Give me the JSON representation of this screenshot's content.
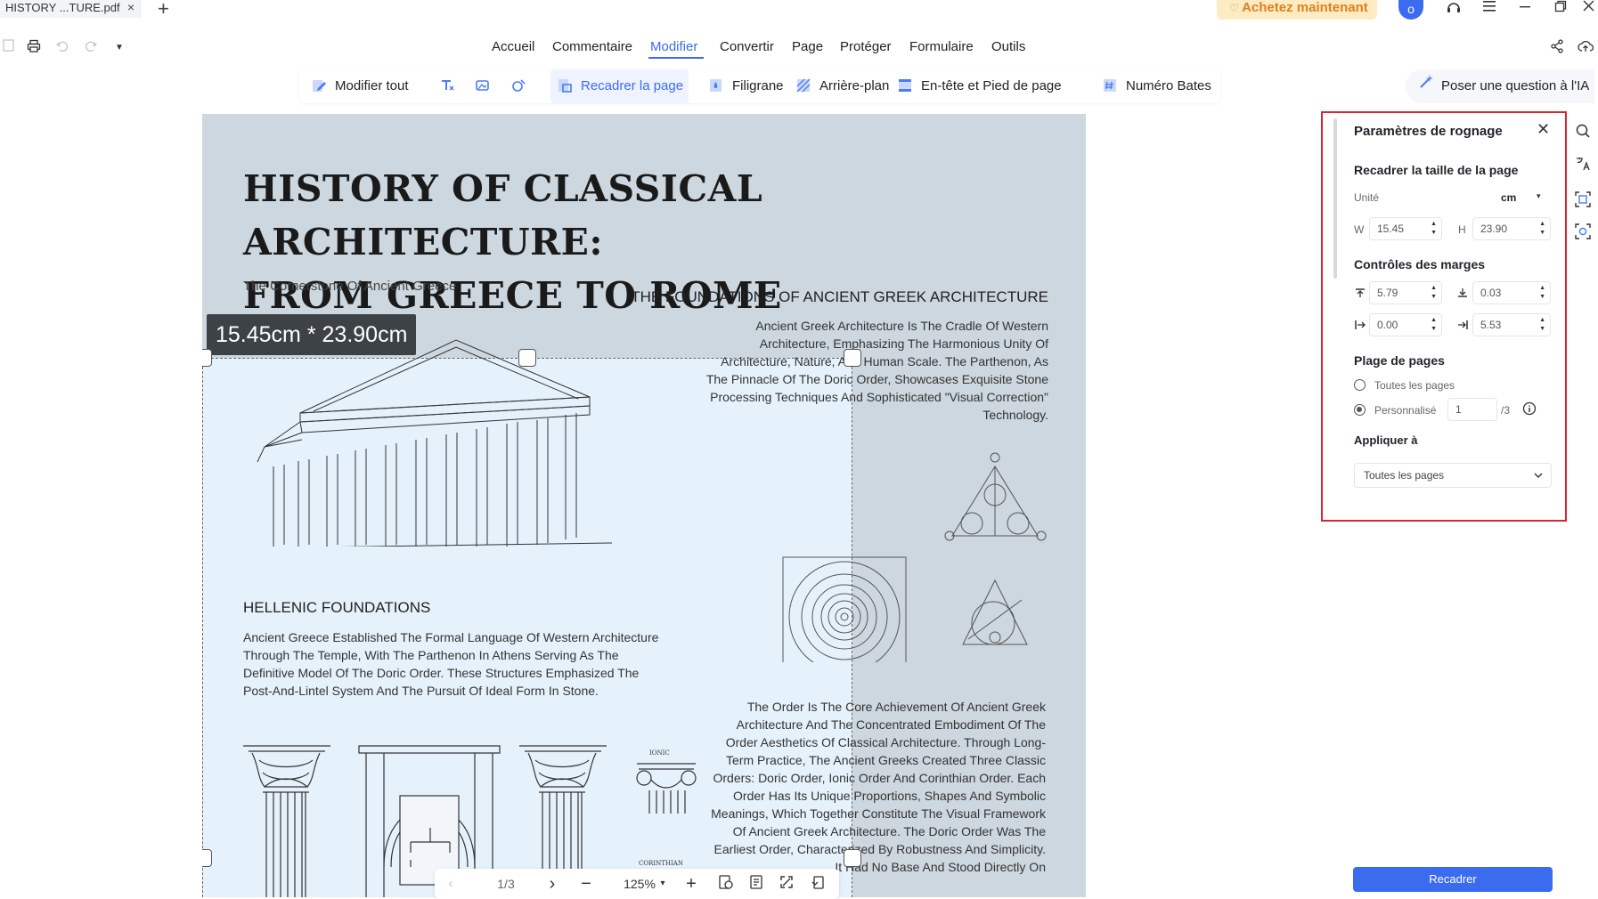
{
  "tab": {
    "title": "HISTORY ...TURE.pdf",
    "close": "×",
    "new_tab": "+"
  },
  "titlebar": {
    "buy_label": "Achetez maintenant",
    "avatar_letter": "o"
  },
  "menu": [
    "Accueil",
    "Commentaire",
    "Modifier",
    "Convertir",
    "Page",
    "Protéger",
    "Formulaire",
    "Outils"
  ],
  "ribbon": {
    "edit_all": "Modifier tout",
    "crop_page": "Recadrer la page",
    "watermark": "Filigrane",
    "background": "Arrière-plan",
    "header_footer": "En-tête et Pied de page",
    "bates": "Numéro Bates"
  },
  "ai_label": "Poser une question à l'IA",
  "document": {
    "title_line1": "HISTORY OF CLASSICAL  ARCHITECTURE:",
    "title_line2": "FROM GREECE TO ROME",
    "subtitle": "The Cornerstone Of Ancient Greece",
    "section_right_heading": "THE FOUNDATIONS OF ANCIENT GREEK ARCHITECTURE",
    "section_right_text": "Ancient Greek Architecture Is The Cradle Of Western Architecture, Emphasizing The Harmonious Unity Of Architecture, Nature, And Human Scale. The Parthenon, As The Pinnacle Of The Doric Order, Showcases Exquisite Stone Processing Techniques And Sophisticated \"Visual Correction\" Technology.",
    "section_left_heading": "HELLENIC FOUNDATIONS",
    "section_left_text": "Ancient Greece Established The Formal Language Of Western Architecture Through The Temple, With The Parthenon In Athens Serving As The Definitive Model Of The Doric Order. These Structures Emphasized The Post-And-Lintel System And The Pursuit Of Ideal Form In Stone.",
    "section_orders_text": "The Order Is The Core Achievement Of Ancient Greek Architecture And The Concentrated Embodiment Of The Order Aesthetics Of Classical Architecture. Through Long-Term Practice, The Ancient Greeks Created Three Classic Orders: Doric Order, Ionic Order And Corinthian Order. Each Order Has Its Unique Proportions, Shapes And Symbolic Meanings, Which Together Constitute The Visual Framework Of Ancient Greek Architecture. The Doric Order Was The Earliest Order, Characterized By Robustness And Simplicity. It Had No Base And Stood Directly On",
    "label_ionic": "IONIC",
    "label_corinthian": "CORINTHIAN",
    "crop_size_badge": "15.45cm * 23.90cm"
  },
  "bottom_nav": {
    "page": "1/3",
    "zoom": "125%",
    "zoom_caret": "▾"
  },
  "panel": {
    "title": "Paramètres de rognage",
    "resize_heading": "Recadrer la taille de la page",
    "unit_label": "Unité",
    "unit_value": "cm",
    "w_label": "W",
    "w_value": "15.45",
    "h_label": "H",
    "h_value": "23.90",
    "margins_heading": "Contrôles des marges",
    "margin_top": "5.79",
    "margin_bottom": "0.03",
    "margin_left": "0.00",
    "margin_right": "5.53",
    "range_heading": "Plage de pages",
    "all_pages": "Toutes les pages",
    "custom": "Personnalisé",
    "custom_value": "1",
    "total_pages": "/3",
    "apply_heading": "Appliquer à",
    "apply_value": "Toutes les pages"
  },
  "recadrer_label": "Recadrer",
  "colors": {
    "accent": "#3b6cf0",
    "highlight_border": "#d8262e",
    "page_bg": "#cdd7df",
    "crop_bg": "#e6f2fb"
  }
}
